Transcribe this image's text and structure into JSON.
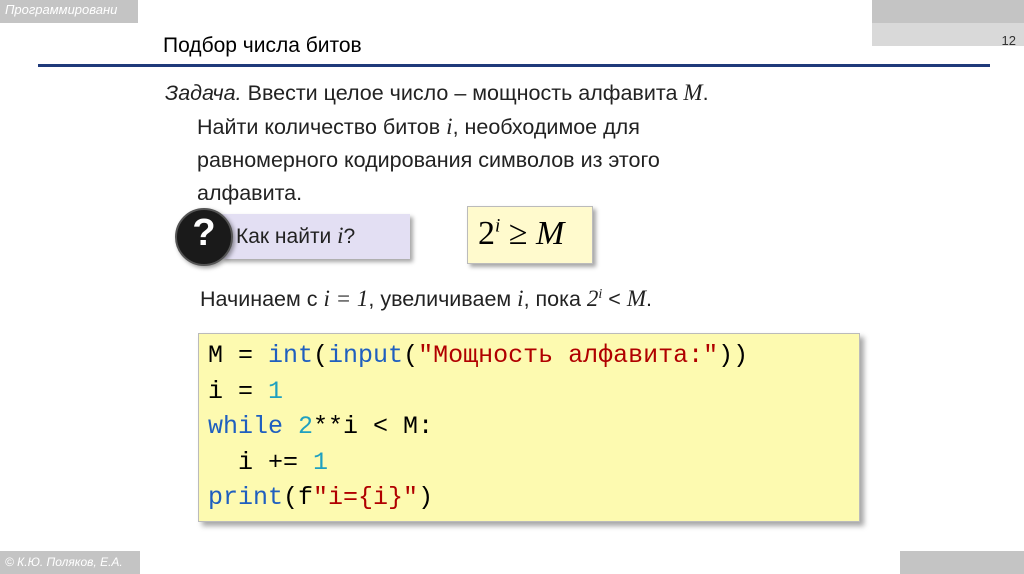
{
  "header": {
    "course_label": "Программировани",
    "page_number": "12"
  },
  "slide": {
    "title": "Подбор числа битов",
    "task_lead": "Задача.",
    "task_line1": " Ввести целое число – мощность алфавита ",
    "task_var_M": "M",
    "task_line1_end": ".",
    "task_line2a": "Найти количество битов ",
    "task_var_i": "i",
    "task_line2b": ", необходимое для",
    "task_line3": "равномерного кодирования символов  из этого",
    "task_line4": "алфавита."
  },
  "question": {
    "icon_glyph": "?",
    "text": "Как найти ",
    "var": "i",
    "end": "?"
  },
  "formula": {
    "base": "2",
    "exp": "i",
    "op": " ≥ ",
    "rhs": "M"
  },
  "begin_text": {
    "a": "Начинаем с ",
    "cond1": "i = 1",
    "b": ", увеличиваем ",
    "var": "i",
    "c": ", пока ",
    "base": "2",
    "exp": "i",
    "lt": " < ",
    "M": "M",
    "end": "."
  },
  "code": {
    "l1_a": "M = ",
    "l1_int": "int",
    "l1_p1": "(",
    "l1_input": "input",
    "l1_p2": "(",
    "l1_str": "\"Мощность алфавита:\"",
    "l1_p3": "))",
    "l2_a": "i = ",
    "l2_num": "1",
    "l3_while": "while",
    "l3_sp": " ",
    "l3_num": "2",
    "l3_rest": "**i < M:",
    "l4_a": "  i += ",
    "l4_num": "1",
    "l5_print": "print",
    "l5_p": "(f",
    "l5_str": "\"i={i}\"",
    "l5_end": ")"
  },
  "footer": {
    "credit": "© К.Ю. Поляков, Е.А."
  }
}
